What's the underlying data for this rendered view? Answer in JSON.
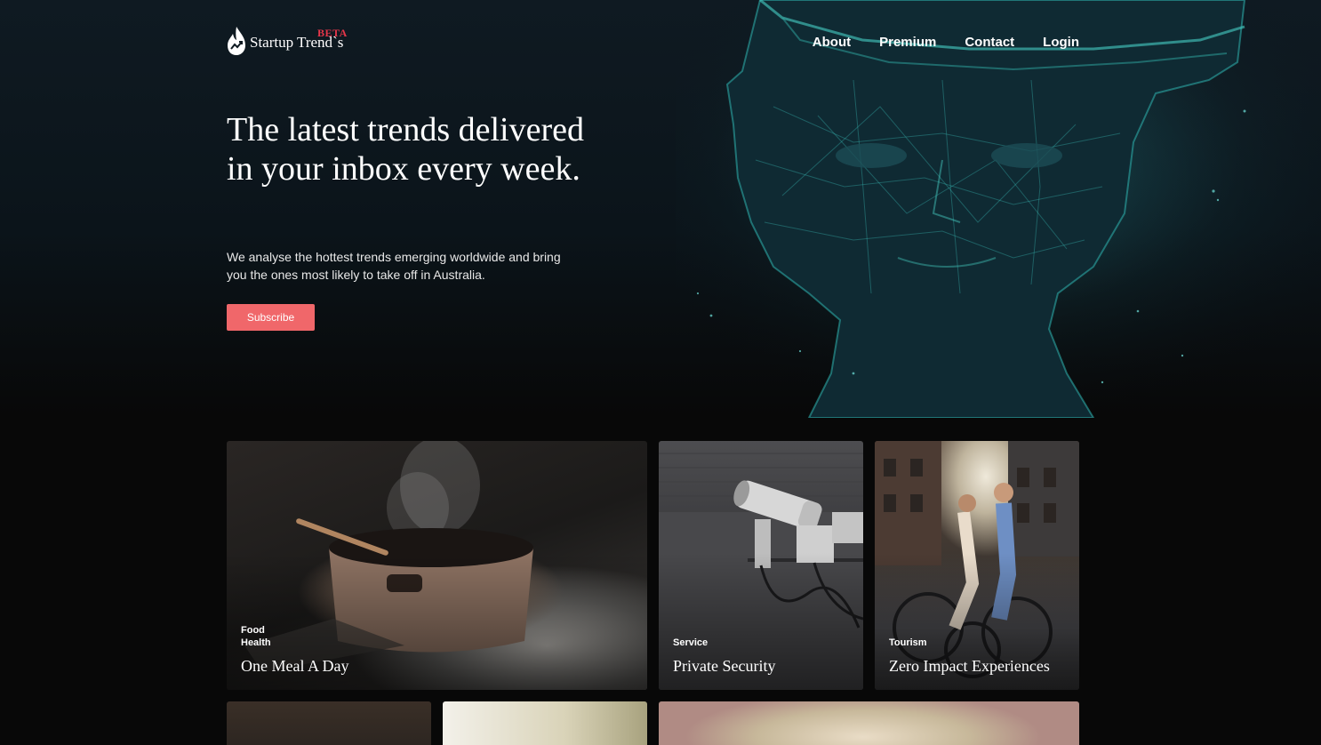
{
  "brand": {
    "name": "Startup Trend`s",
    "badge": "BETA",
    "accent_color": "#e6364a"
  },
  "nav": {
    "items": [
      {
        "label": "About"
      },
      {
        "label": "Premium"
      },
      {
        "label": "Contact"
      },
      {
        "label": "Login"
      }
    ]
  },
  "hero": {
    "headline": "The latest trends delivered in your inbox every week.",
    "subtext": "We analyse the hottest trends emerging worldwide and bring you the ones most likely to take off in Australia.",
    "cta_label": "Subscribe",
    "cta_color": "#f0676a",
    "image_icon": "digital-head-icon"
  },
  "cards": [
    {
      "tags": [
        "Food",
        "Health"
      ],
      "title": "One Meal A Day",
      "image": "steaming-pot-photo"
    },
    {
      "tags": [
        "Service"
      ],
      "title": "Private Security",
      "image": "security-camera-photo"
    },
    {
      "tags": [
        "Tourism"
      ],
      "title": "Zero Impact Experiences",
      "image": "cyclists-photo"
    },
    {
      "tags": [],
      "title": "",
      "image": "room-photo"
    },
    {
      "tags": [],
      "title": "",
      "image": "sunlit-field-photo"
    },
    {
      "tags": [],
      "title": "",
      "image": "glass-closeup-photo"
    }
  ]
}
